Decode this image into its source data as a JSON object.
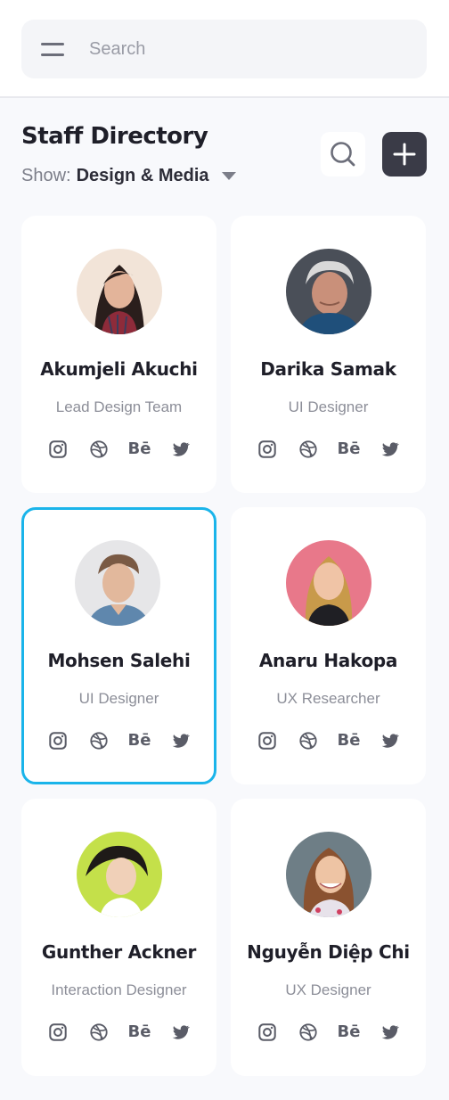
{
  "search": {
    "placeholder": "Search"
  },
  "header": {
    "title": "Staff Directory",
    "filter_label": "Show:",
    "filter_value": "Design & Media"
  },
  "icons": {
    "menu": "menu-icon",
    "search": "search-icon",
    "add": "plus-icon",
    "filter": "caret-down-icon",
    "social": [
      "instagram-icon",
      "dribbble-icon",
      "behance-icon",
      "twitter-icon"
    ]
  },
  "colors": {
    "accent_selected": "#1ab4ea",
    "add_button": "#3a3b47",
    "background": "#f8f9fc"
  },
  "social_labels": {
    "behance": "Bē"
  },
  "staff": [
    {
      "name": "Akumjeli Akuchi",
      "role": "Lead Design Team",
      "selected": false
    },
    {
      "name": "Darika Samak",
      "role": "UI Designer",
      "selected": false
    },
    {
      "name": "Mohsen Salehi",
      "role": "UI Designer",
      "selected": true
    },
    {
      "name": "Anaru Hakopa",
      "role": "UX Researcher",
      "selected": false
    },
    {
      "name": "Gunther Ackner",
      "role": "Interaction Designer",
      "selected": false
    },
    {
      "name": "Nguyễn Diệp Chi",
      "role": "UX Designer",
      "selected": false
    }
  ]
}
